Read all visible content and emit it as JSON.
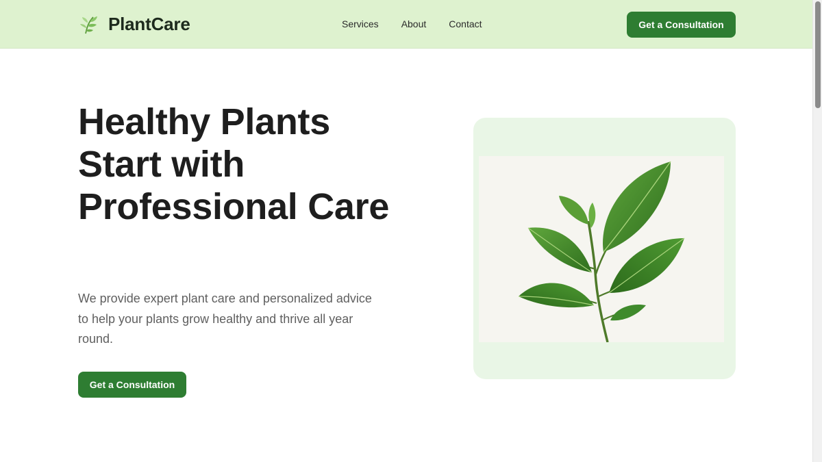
{
  "header": {
    "brand": "PlantCare",
    "nav": [
      {
        "label": "Services"
      },
      {
        "label": "About"
      },
      {
        "label": "Contact"
      }
    ],
    "cta_label": "Get a Consultation"
  },
  "hero": {
    "title": "Healthy Plants Start with Professional Care",
    "description": "We provide expert plant care and personalized advice to help your plants grow healthy and thrive all year round.",
    "cta_label": "Get a Consultation"
  },
  "icons": {
    "logo": "leaf-sprig-icon",
    "hero_image": "plant-leaves-image"
  },
  "colors": {
    "header_bg": "#def2cf",
    "primary": "#2e7d32",
    "image_card_bg": "#e9f6e6",
    "leaf": "#3f8a2c"
  }
}
